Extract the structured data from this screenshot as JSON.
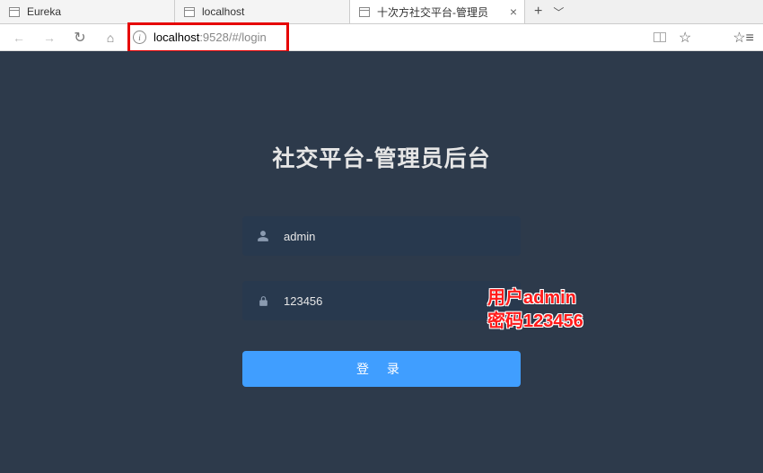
{
  "browser": {
    "tabs": [
      {
        "label": "Eureka",
        "active": false
      },
      {
        "label": "localhost",
        "active": false
      },
      {
        "label": "十次方社交平台-管理员",
        "active": true
      }
    ],
    "url_host": "localhost",
    "url_rest": ":9528/#/login"
  },
  "page": {
    "title": "社交平台-管理员后台",
    "username_value": "admin",
    "password_value": "123456",
    "login_button_label": "登 录"
  },
  "annotation": {
    "line1": "用户admin",
    "line2": "密码123456"
  }
}
